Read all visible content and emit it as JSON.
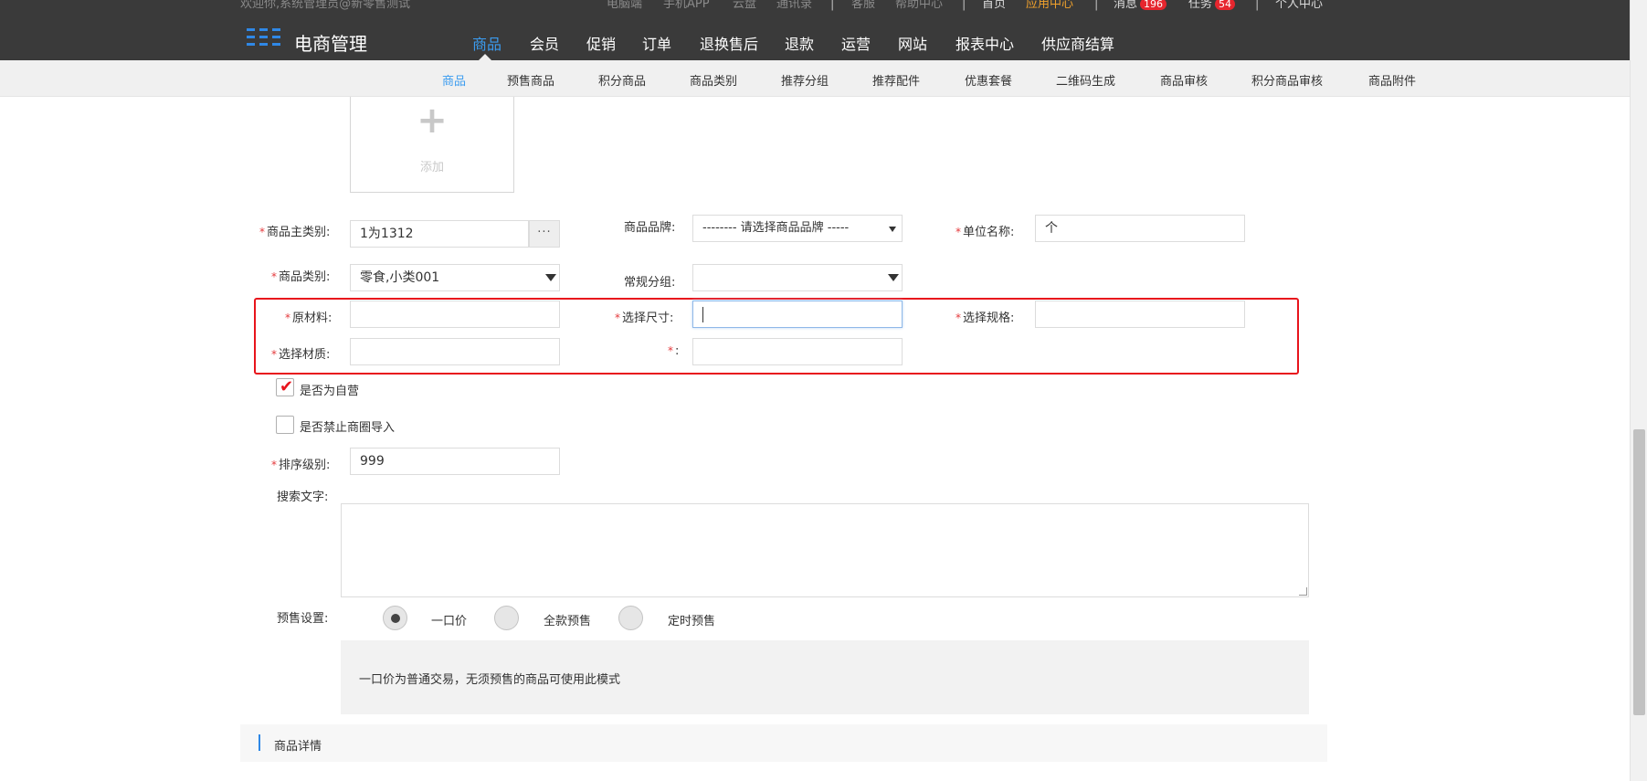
{
  "topbar": {
    "welcome": "欢迎你,系统管理员@新零售测试",
    "links": [
      "电脑端",
      "手机APP",
      "云盘",
      "通讯录",
      "客服",
      "帮助中心"
    ],
    "separator": "|",
    "home": "首页",
    "app_center": "应用中心",
    "messages_label": "消息",
    "messages_count": "196",
    "tasks_label": "任务",
    "tasks_count": "54",
    "personal_center": "个人中心"
  },
  "brand": {
    "title": "电商管理",
    "icon": "grid-logo-icon"
  },
  "main_nav": [
    "商品",
    "会员",
    "促销",
    "订单",
    "退换售后",
    "退款",
    "运营",
    "网站",
    "报表中心",
    "供应商结算"
  ],
  "sub_nav": [
    "商品",
    "预售商品",
    "积分商品",
    "商品类别",
    "推荐分组",
    "推荐配件",
    "优惠套餐",
    "二维码生成",
    "商品审核",
    "积分商品审核",
    "商品附件"
  ],
  "upload": {
    "plus": "+",
    "label": "添加"
  },
  "form": {
    "required_mark": "*",
    "main_category_label": "商品主类别:",
    "main_category_value": "1为1312",
    "ellipsis": "···",
    "brand_label": "商品品牌:",
    "brand_placeholder": "-------- 请选择商品品牌 -----",
    "unit_label": "单位名称:",
    "unit_value": "个",
    "category_label": "商品类别:",
    "category_value": "零食,小类001",
    "group_label": "常规分组:",
    "group_value": "",
    "raw_material_label": "原材料:",
    "raw_material_value": "",
    "size_label": "选择尺寸:",
    "size_value": "",
    "spec_label": "选择规格:",
    "spec_value": "",
    "texture_label": "选择材质:",
    "texture_value": "",
    "unnamed_label": ":",
    "unnamed_value": "",
    "self_operated_label": "是否为自营",
    "self_operated_checked": true,
    "check_glyph": "✔",
    "block_import_label": "是否禁止商圈导入",
    "block_import_checked": false,
    "sort_label": "排序级别:",
    "sort_value": "999",
    "search_text_label": "搜索文字:",
    "search_text_value": "",
    "presale_label": "预售设置:",
    "presale_options": [
      "一口价",
      "全款预售",
      "定时预售"
    ],
    "presale_selected": "一口价",
    "presale_note": "一口价为普通交易，无须预售的商品可使用此模式"
  },
  "details_section": {
    "title": "商品详情"
  },
  "colors": {
    "topbar_bg": "#3a3a3a",
    "accent_blue": "#3b9cf0",
    "app_center_orange": "#f0a12c",
    "badge_red": "#e6262e",
    "highlight_red": "#e8141c",
    "required_red": "#e4393c"
  }
}
